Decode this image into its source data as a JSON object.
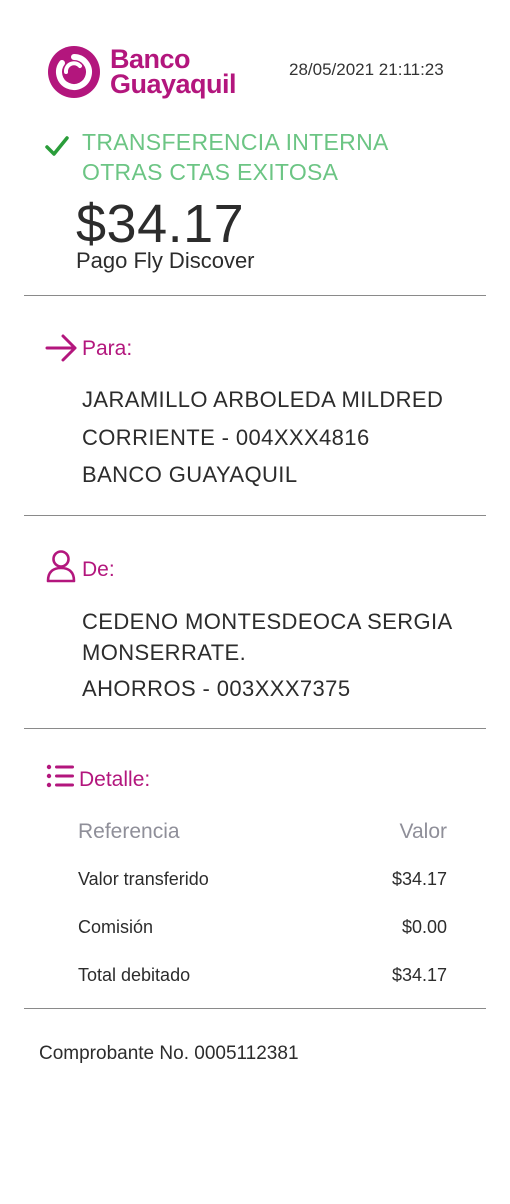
{
  "header": {
    "brand_line1": "Banco",
    "brand_line2": "Guayaquil",
    "datetime": "28/05/2021 21:11:23"
  },
  "status": {
    "line1": "TRANSFERENCIA INTERNA",
    "line2": "OTRAS CTAS EXITOSA",
    "icon": "check-icon"
  },
  "amount": "$34.17",
  "description": "Pago Fly Discover",
  "para": {
    "label": "Para:",
    "icon": "arrow-right-icon",
    "lines": [
      "JARAMILLO ARBOLEDA MILDRED",
      "CORRIENTE - 004XXX4816",
      "BANCO GUAYAQUIL"
    ]
  },
  "de": {
    "label": "De:",
    "icon": "user-icon",
    "lines": [
      "CEDENO MONTESDEOCA SERGIA",
      "MONSERRATE.",
      "AHORROS - 003XXX7375"
    ]
  },
  "detalle": {
    "label": "Detalle:",
    "icon": "list-icon",
    "headers": {
      "ref": "Referencia",
      "val": "Valor"
    },
    "rows": [
      {
        "ref": "Valor transferido",
        "val": "$34.17"
      },
      {
        "ref": "Comisión",
        "val": "$0.00"
      },
      {
        "ref": "Total debitado",
        "val": "$34.17"
      }
    ]
  },
  "footer": "Comprobante No. 0005112381",
  "colors": {
    "brand": "#b3167d",
    "success": "#6cc584",
    "divider": "#8a8a8a",
    "muted": "#8f8f99"
  }
}
